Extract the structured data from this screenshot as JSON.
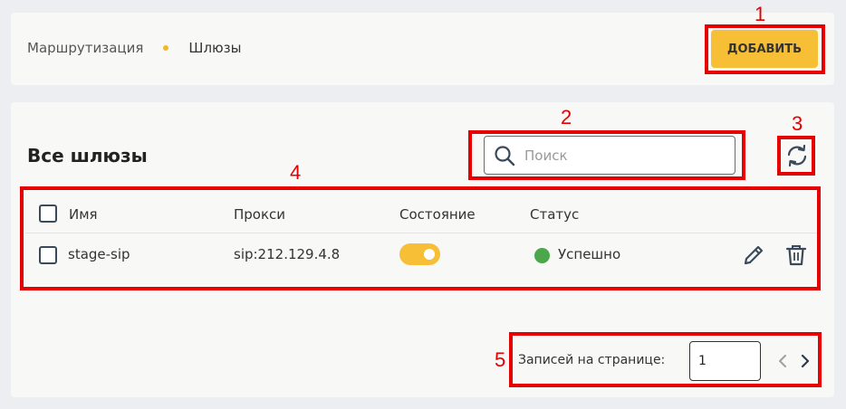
{
  "breadcrumb": {
    "parent": "Маршрутизация",
    "current": "Шлюзы"
  },
  "header": {
    "add_label": "ДОБАВИТЬ"
  },
  "main": {
    "title": "Все шлюзы",
    "search": {
      "placeholder": "Поиск",
      "value": ""
    }
  },
  "table": {
    "columns": [
      "Имя",
      "Прокси",
      "Состояние",
      "Статус"
    ],
    "rows": [
      {
        "name": "stage-sip",
        "proxy": "sip:212.129.4.8",
        "enabled": true,
        "status": "Успешно"
      }
    ]
  },
  "pagination": {
    "label": "Записей на странице:",
    "per_page": "1"
  },
  "annotations": [
    "1",
    "2",
    "3",
    "4",
    "5"
  ],
  "icons": [
    "search-icon",
    "refresh-icon",
    "edit-icon",
    "trash-icon",
    "chevron-left-icon",
    "chevron-right-icon"
  ],
  "colors": {
    "accent": "#f6bf36",
    "status_success": "#4aa84a",
    "annotation": "#e60000"
  }
}
